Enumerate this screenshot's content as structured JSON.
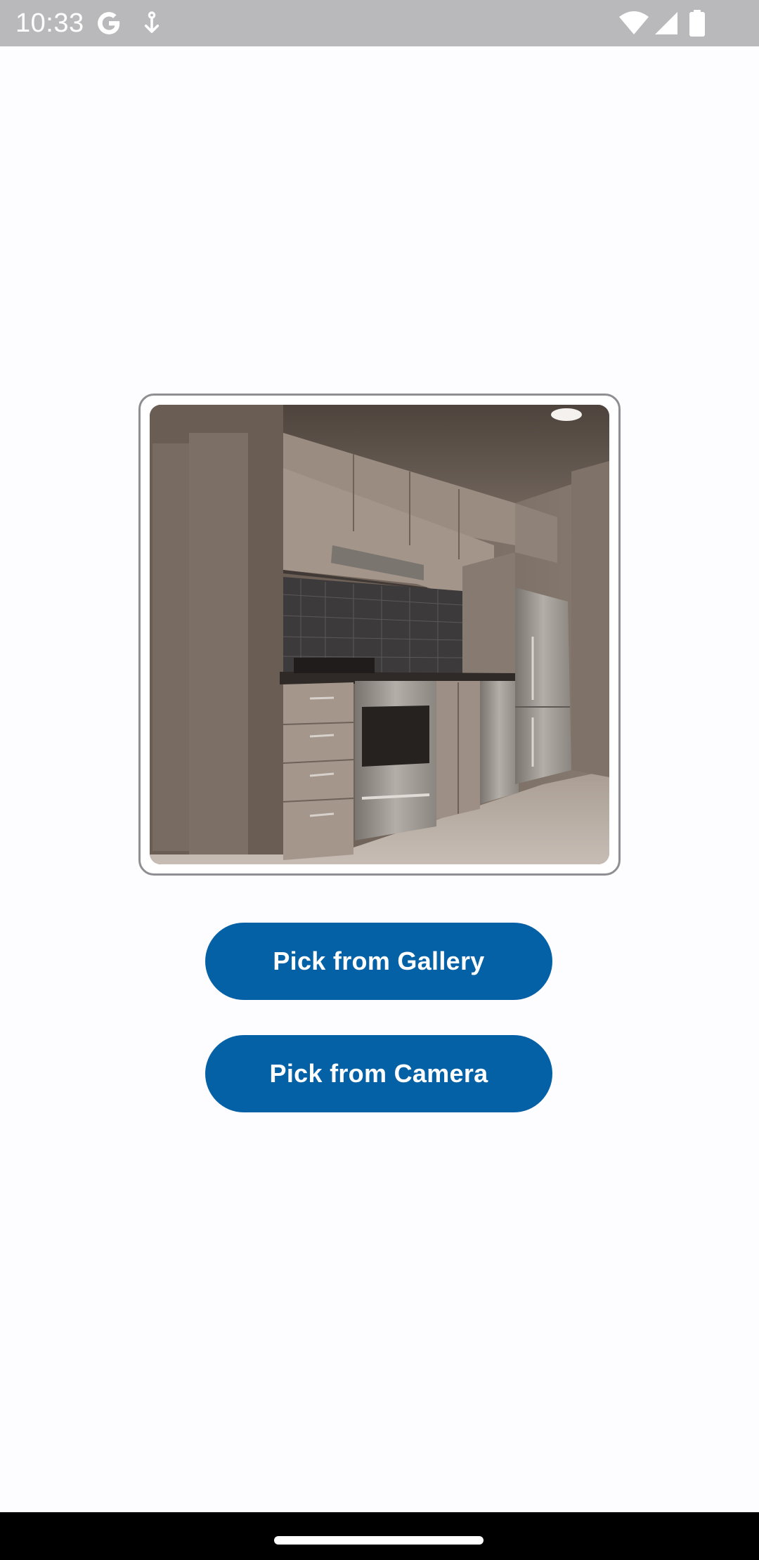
{
  "status_bar": {
    "time": "10:33",
    "icons": [
      "google-g-icon",
      "download-icon",
      "wifi-icon",
      "cellular-signal-icon",
      "battery-icon"
    ],
    "background_color": "#b9b9bb"
  },
  "image_preview": {
    "description_icon": "kitchen-photo"
  },
  "actions": {
    "gallery_label": "Pick from Gallery",
    "camera_label": "Pick from Camera",
    "button_color": "#0561a6"
  },
  "nav_bar": {
    "background_color": "#000000"
  }
}
